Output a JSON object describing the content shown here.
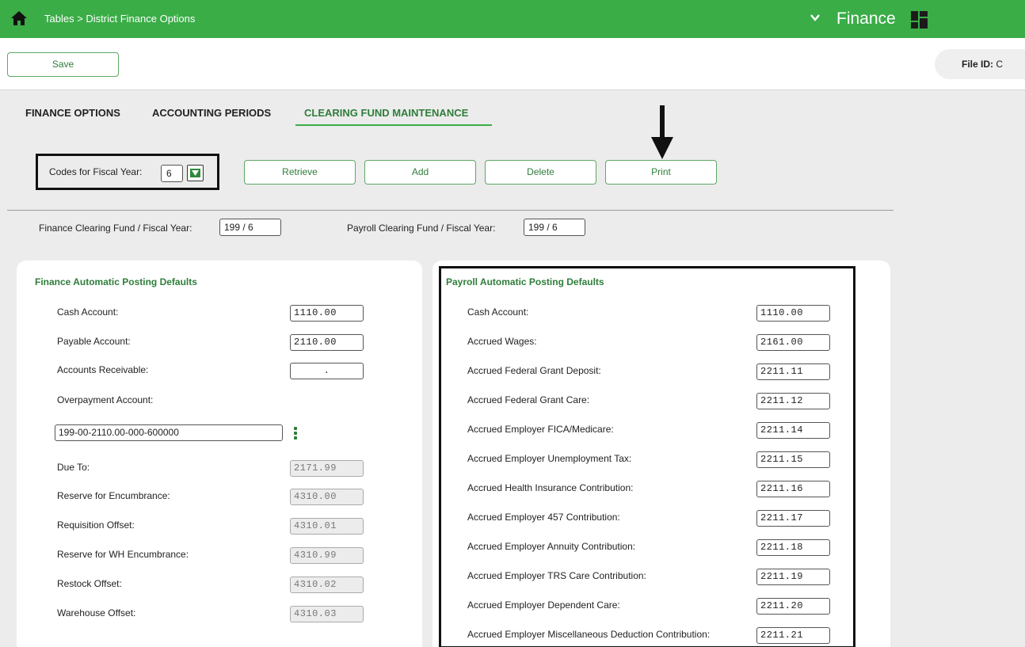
{
  "header": {
    "breadcrumb": "Tables > District Finance Options",
    "module": "Finance",
    "icons": [
      "home-icon",
      "chevron-down-icon",
      "grid-icon"
    ]
  },
  "toolbar": {
    "save_label": "Save",
    "file_id_label": "File ID:",
    "file_id_value": "C"
  },
  "tabs": [
    {
      "label": "FINANCE OPTIONS",
      "active": false
    },
    {
      "label": "ACCOUNTING PERIODS",
      "active": false
    },
    {
      "label": "CLEARING FUND MAINTENANCE",
      "active": true
    }
  ],
  "fiscal_year": {
    "label": "Codes for Fiscal Year:",
    "value": "6"
  },
  "actions": {
    "retrieve": "Retrieve",
    "add": "Add",
    "delete": "Delete",
    "print": "Print"
  },
  "clearing_funds": {
    "finance_label": "Finance Clearing Fund / Fiscal Year:",
    "finance_value": "199 / 6",
    "payroll_label": "Payroll Clearing Fund / Fiscal Year:",
    "payroll_value": "199 / 6"
  },
  "finance_defaults": {
    "title": "Finance Automatic Posting Defaults",
    "rows": [
      {
        "label": "Cash Account:",
        "value": "1110.00"
      },
      {
        "label": "Payable Account:",
        "value": "2110.00"
      },
      {
        "label": "Accounts Receivable:",
        "value": "."
      }
    ],
    "overpayment_label": "Overpayment Account:",
    "overpayment_value": "199-00-2110.00-000-600000",
    "readonly_rows": [
      {
        "label": "Due To:",
        "value": "2171.99"
      },
      {
        "label": "Reserve for Encumbrance:",
        "value": "4310.00"
      },
      {
        "label": "Requisition Offset:",
        "value": "4310.01"
      },
      {
        "label": "Reserve for WH Encumbrance:",
        "value": "4310.99"
      },
      {
        "label": "Restock Offset:",
        "value": "4310.02"
      },
      {
        "label": "Warehouse Offset:",
        "value": "4310.03"
      }
    ]
  },
  "payroll_defaults": {
    "title": "Payroll Automatic Posting Defaults",
    "rows": [
      {
        "label": "Cash Account:",
        "value": "1110.00"
      },
      {
        "label": "Accrued Wages:",
        "value": "2161.00"
      },
      {
        "label": "Accrued Federal Grant Deposit:",
        "value": "2211.11"
      },
      {
        "label": "Accrued Federal Grant Care:",
        "value": "2211.12"
      },
      {
        "label": "Accrued Employer FICA/Medicare:",
        "value": "2211.14"
      },
      {
        "label": "Accrued Employer Unemployment Tax:",
        "value": "2211.15"
      },
      {
        "label": "Accrued Health Insurance Contribution:",
        "value": "2211.16"
      },
      {
        "label": "Accrued Employer 457 Contribution:",
        "value": "2211.17"
      },
      {
        "label": "Accrued Employer Annuity Contribution:",
        "value": "2211.18"
      },
      {
        "label": "Accrued Employer TRS Care Contribution:",
        "value": "2211.19"
      },
      {
        "label": "Accrued Employer Dependent Care:",
        "value": "2211.20"
      },
      {
        "label": "Accrued Employer Miscellaneous Deduction Contribution:",
        "value": "2211.21"
      }
    ]
  },
  "colors": {
    "brand_green": "#3aad47",
    "accent_green": "#2e7d3a"
  }
}
